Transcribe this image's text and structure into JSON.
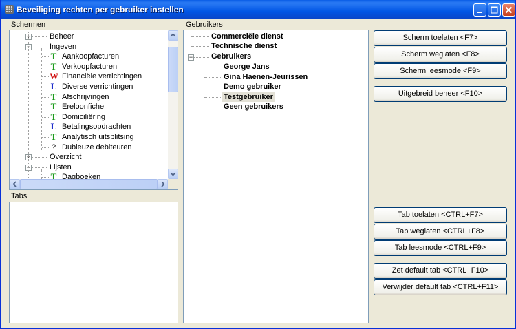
{
  "window": {
    "title": "Beveiliging rechten per gebruiker instellen"
  },
  "labels": {
    "schermen": "Schermen",
    "tabs": "Tabs",
    "gebruikers": "Gebruikers"
  },
  "schermen_tree": [
    {
      "label": "Beheer",
      "expander": "+",
      "icon": ""
    },
    {
      "label": "Ingeven",
      "expander": "-",
      "icon": ""
    },
    {
      "label": "Aankoopfacturen",
      "icon": "T",
      "color": "#1a9a1a"
    },
    {
      "label": "Verkoopfacturen",
      "icon": "T",
      "color": "#1a9a1a"
    },
    {
      "label": "Financiële verrichtingen",
      "icon": "W",
      "color": "#d01010"
    },
    {
      "label": "Diverse verrichtingen",
      "icon": "L",
      "color": "#1020c8"
    },
    {
      "label": "Afschrijvingen",
      "icon": "T",
      "color": "#1a9a1a"
    },
    {
      "label": "Ereloonfiche",
      "icon": "T",
      "color": "#1a9a1a"
    },
    {
      "label": "Domiciliëring",
      "icon": "T",
      "color": "#1a9a1a"
    },
    {
      "label": "Betalingsopdrachten",
      "icon": "L",
      "color": "#1020c8"
    },
    {
      "label": "Analytisch uitsplitsing",
      "icon": "T",
      "color": "#1a9a1a"
    },
    {
      "label": "Dubieuze debiteuren",
      "icon": "?",
      "color": "#000000"
    },
    {
      "label": "Overzicht",
      "expander": "+",
      "icon": ""
    },
    {
      "label": "Lijsten",
      "expander": "-",
      "icon": ""
    },
    {
      "label": "Dagboeken",
      "icon": "T",
      "color": "#1a9a1a"
    }
  ],
  "gebruikers_tree": {
    "top": [
      "Commerciële dienst",
      "Technische dienst"
    ],
    "group": "Gebruikers",
    "users": [
      "George Jans",
      "Gina Haenen-Jeurissen",
      "Demo gebruiker",
      "Testgebruiker",
      "Geen gebruikers"
    ],
    "selected_index": 3
  },
  "buttons": {
    "scherm_toelaten": "Scherm toelaten <F7>",
    "scherm_weglaten": "Scherm weglaten <F8>",
    "scherm_leesmode": "Scherm leesmode <F9>",
    "uitgebreid_beheer": "Uitgebreid beheer <F10>",
    "tab_toelaten": "Tab toelaten <CTRL+F7>",
    "tab_weglaten": "Tab weglaten <CTRL+F8>",
    "tab_leesmode": "Tab leesmode <CTRL+F9>",
    "zet_default_tab": "Zet default tab <CTRL+F10>",
    "verwijder_default_tab": "Verwijder default tab <CTRL+F11>"
  },
  "colors": {
    "titlebar": "#0055e5",
    "window_bg": "#ece9d8",
    "panel_border": "#7f9db9"
  }
}
